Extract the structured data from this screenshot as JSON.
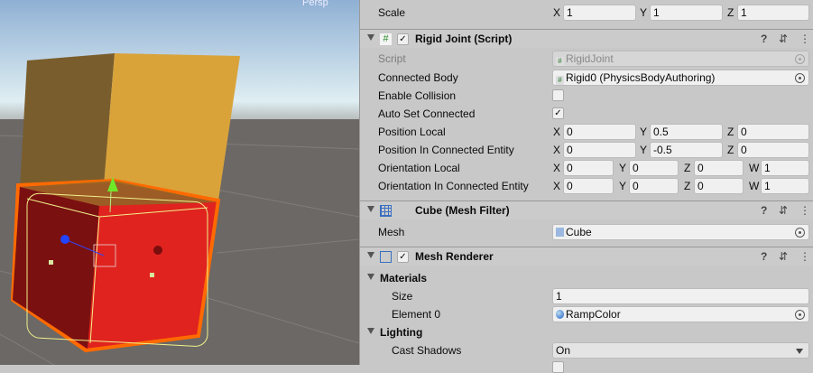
{
  "scene": {
    "view_label": "Persp",
    "colors": {
      "top_cube": "#d9a33a",
      "selected_cube": "#e0231f",
      "outline": "#ff6a00",
      "ground": "#6b6866"
    }
  },
  "transform": {
    "scale": {
      "label": "Scale",
      "x": "1",
      "y": "1",
      "z": "1"
    }
  },
  "rigid_joint": {
    "title": "Rigid Joint (Script)",
    "enabled": true,
    "icon": "script-hash-icon",
    "script": {
      "label": "Script",
      "value": "RigidJoint"
    },
    "connected_body": {
      "label": "Connected Body",
      "value": "Rigid0 (PhysicsBodyAuthoring)"
    },
    "enable_collision": {
      "label": "Enable Collision",
      "checked": false
    },
    "auto_set_connected": {
      "label": "Auto Set Connected",
      "checked": true
    },
    "position_local": {
      "label": "Position Local",
      "x": "0",
      "y": "0.5",
      "z": "0"
    },
    "position_in_connected": {
      "label": "Position In Connected Entity",
      "x": "0",
      "y": "-0.5",
      "z": "0"
    },
    "orientation_local": {
      "label": "Orientation Local",
      "x": "0",
      "y": "0",
      "z": "0",
      "w": "1"
    },
    "orientation_in_connected": {
      "label": "Orientation In Connected Entity",
      "x": "0",
      "y": "0",
      "z": "0",
      "w": "1"
    }
  },
  "mesh_filter": {
    "title": "Cube (Mesh Filter)",
    "mesh": {
      "label": "Mesh",
      "value": "Cube"
    }
  },
  "mesh_renderer": {
    "title": "Mesh Renderer",
    "enabled": true,
    "materials": {
      "label": "Materials",
      "size_label": "Size",
      "size": "1",
      "element0_label": "Element 0",
      "element0": "RampColor"
    },
    "lighting": {
      "label": "Lighting",
      "cast_shadows_label": "Cast Shadows",
      "cast_shadows": "On"
    }
  },
  "axes": {
    "x": "X",
    "y": "Y",
    "z": "Z",
    "w": "W"
  },
  "icons": {
    "help": "?",
    "preset": "⇵",
    "more": "⋮",
    "check": "✓"
  }
}
